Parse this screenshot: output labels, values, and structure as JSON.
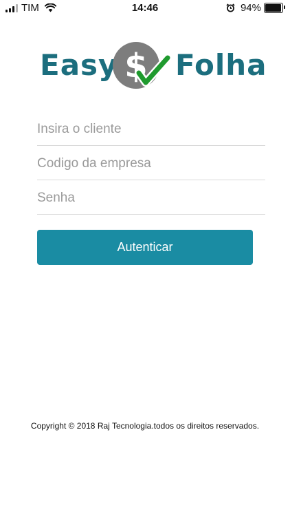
{
  "status_bar": {
    "carrier": "TIM",
    "time": "14:46",
    "battery_percent": "94%",
    "battery_level": 0.94,
    "icons": [
      "signal-icon",
      "wifi-icon",
      "alarm-icon",
      "battery-icon"
    ]
  },
  "logo": {
    "left_text": "Easy",
    "right_text": "Folha",
    "mark_symbol": "$",
    "brand_color": "#1c6e7e",
    "mark_circle_color": "#7d7d7d",
    "check_color": "#1f9a2e"
  },
  "form": {
    "client_placeholder": "Insira o cliente",
    "company_code_placeholder": "Codigo da empresa",
    "password_placeholder": "Senha",
    "submit_label": "Autenticar",
    "button_color": "#1a8ca3"
  },
  "footer": {
    "copyright": "Copyright © 2018 Raj Tecnologia.todos os direitos reservados."
  }
}
